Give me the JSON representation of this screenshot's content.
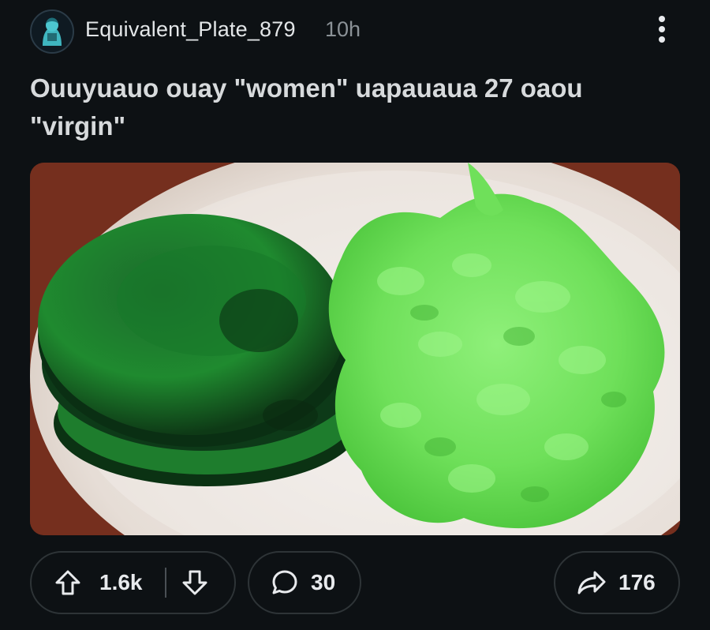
{
  "post": {
    "author": "Equivalent_Plate_879",
    "time_ago": "10h",
    "title": "Ouuyuauo ouay \"women\" uapauaua 27 oaou \"virgin\""
  },
  "media": {
    "description_icon": "photo"
  },
  "actions": {
    "upvotes": "1.6k",
    "comments": "30",
    "shares": "176"
  },
  "icons": {
    "more": "more-vertical-icon",
    "upvote": "arrow-up-icon",
    "downvote": "arrow-down-icon",
    "comment": "comment-bubble-icon",
    "share": "share-arrow-icon"
  },
  "colors": {
    "background": "#0d1114",
    "text": "#d7dadc",
    "muted": "#8b9297",
    "border": "#2e3437"
  }
}
